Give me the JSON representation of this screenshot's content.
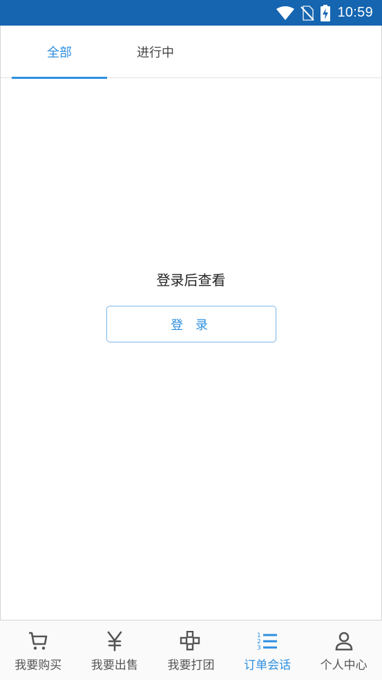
{
  "status_bar": {
    "time": "10:59",
    "icons": [
      "wifi-icon",
      "no-sim-icon",
      "battery-charging-icon"
    ]
  },
  "tabs": [
    {
      "label": "全部",
      "active": true
    },
    {
      "label": "进行中",
      "active": false
    }
  ],
  "empty_state": {
    "message": "登录后查看",
    "button_label": "登 录"
  },
  "bottom_nav": [
    {
      "label": "我要购买",
      "icon": "cart-icon",
      "active": false
    },
    {
      "label": "我要出售",
      "icon": "yen-icon",
      "active": false
    },
    {
      "label": "我要打团",
      "icon": "gamepad-icon",
      "active": false
    },
    {
      "label": "订单会话",
      "icon": "numbered-list-icon",
      "active": true
    },
    {
      "label": "个人中心",
      "icon": "user-icon",
      "active": false
    }
  ],
  "colors": {
    "status_bar": "#1565b0",
    "accent": "#2d8fe0",
    "text": "#444444"
  }
}
